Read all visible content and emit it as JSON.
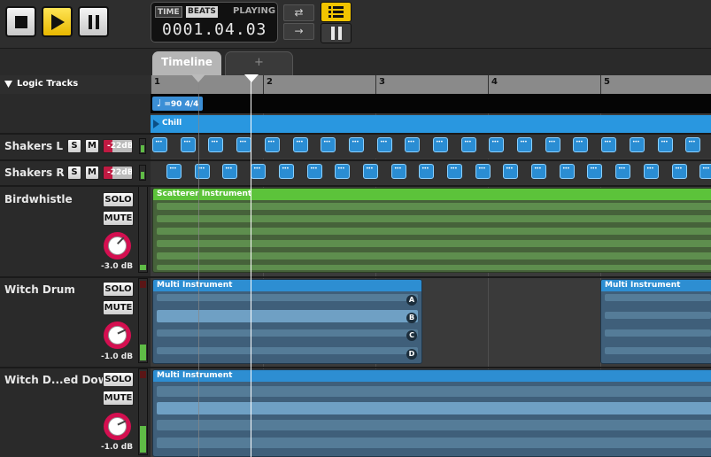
{
  "transport": {
    "time_label": "TIME",
    "beats_label": "BEATS",
    "status": "PLAYING",
    "counter": "0001.04.03",
    "loop_icon": "⇄",
    "arrow_icon": "→"
  },
  "tabs": {
    "timeline": "Timeline",
    "add": "+"
  },
  "tracks_header": "Logic Tracks",
  "ruler": {
    "bars": [
      "1",
      "2",
      "3",
      "4",
      "5"
    ]
  },
  "tempo": "=90 4/4",
  "tempo_icon": "♩",
  "section_label": "Chill",
  "tracks": [
    {
      "name": "Shakers L",
      "s": "S",
      "m": "M",
      "volume": "-22dB"
    },
    {
      "name": "Shakers R",
      "s": "S",
      "m": "M",
      "volume": "-22dB"
    },
    {
      "name": "Birdwhistle",
      "solo": "SOLO",
      "mute": "MUTE",
      "db": "-3.0 dB",
      "clip": "Scatterer Instrument"
    },
    {
      "name": "Witch Drum",
      "solo": "SOLO",
      "mute": "MUTE",
      "db": "-1.0 dB",
      "clip": "Multi Instrument",
      "clip2": "Multi Instrument",
      "pads": [
        "A",
        "B",
        "C",
        "D"
      ]
    },
    {
      "name": "Witch D...ed Down",
      "solo": "SOLO",
      "mute": "MUTE",
      "db": "-1.0 dB",
      "clip": "Multi Instrument"
    }
  ],
  "colors": {
    "play": "#f2c400",
    "note": "#2a8dd3",
    "scatter": "#5cc33a",
    "multi": "#2d8ed2",
    "knob": "#d40f50"
  }
}
